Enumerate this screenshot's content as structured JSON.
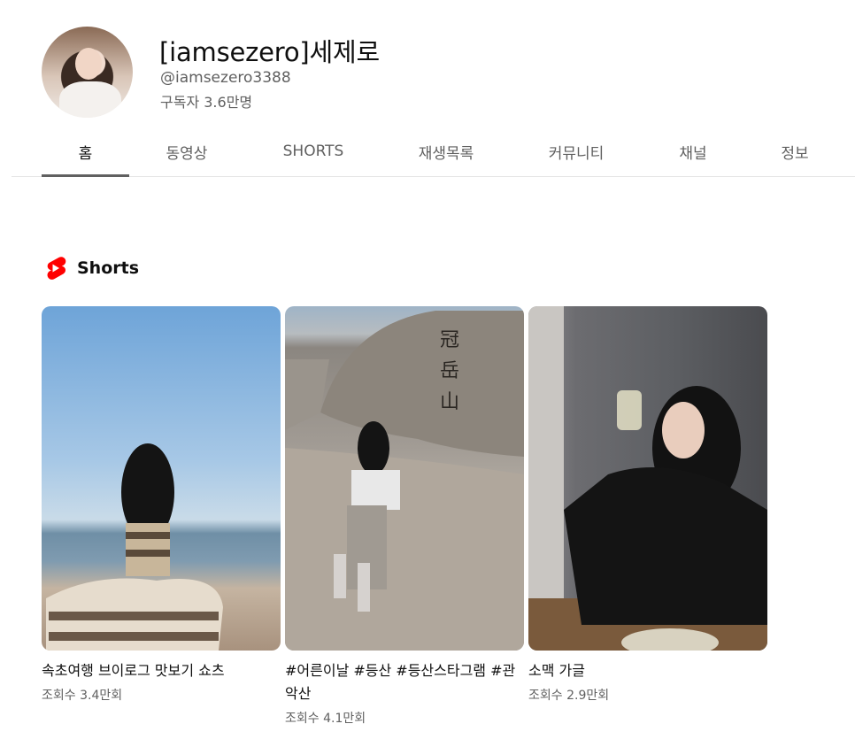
{
  "channel": {
    "name": "[iamsezero]세제로",
    "handle": "@iamsezero3388",
    "subscribers": "구독자 3.6만명"
  },
  "tabs": [
    {
      "label": "홈",
      "active": true
    },
    {
      "label": "동영상",
      "active": false
    },
    {
      "label": "SHORTS",
      "active": false
    },
    {
      "label": "재생목록",
      "active": false
    },
    {
      "label": "커뮤니티",
      "active": false
    },
    {
      "label": "채널",
      "active": false
    },
    {
      "label": "정보",
      "active": false
    }
  ],
  "shorts_section": {
    "title": "Shorts",
    "icon": "youtube-shorts-icon",
    "accent_color": "#ff0000",
    "items": [
      {
        "title": "속초여행 브이로그 맛보기 쇼츠",
        "views": "조회수 3.4만회"
      },
      {
        "title": "#어른이날 #등산 #등산스타그램 #관악산",
        "views": "조회수 4.1만회"
      },
      {
        "title": "소맥 가글",
        "views": "조회수 2.9만회"
      }
    ]
  }
}
